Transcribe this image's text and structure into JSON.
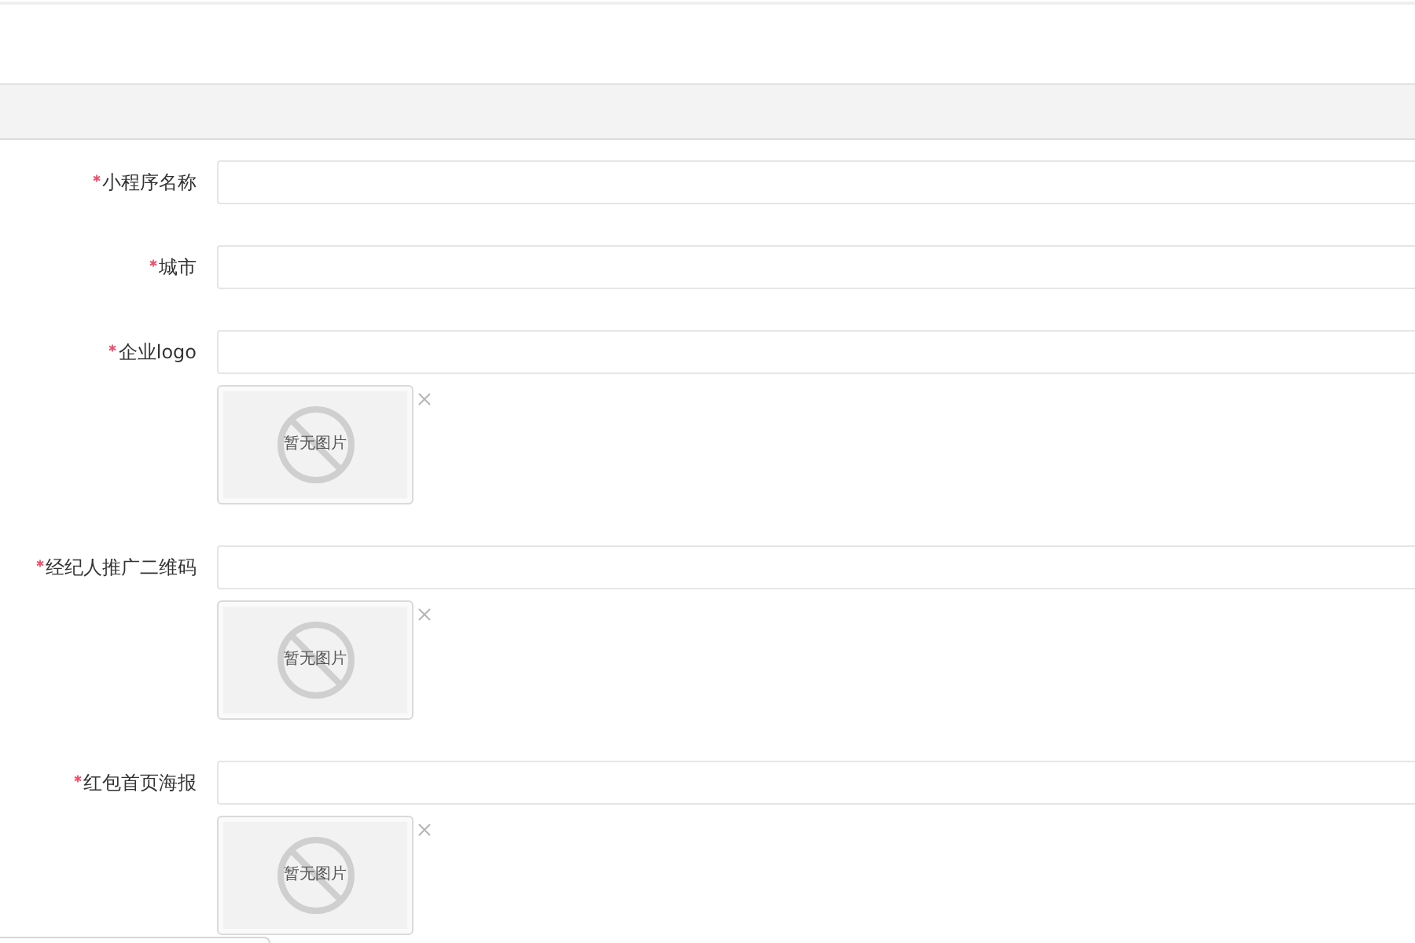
{
  "form": {
    "fields": [
      {
        "label": "小程序名称",
        "required": true,
        "kind": "text"
      },
      {
        "label": "城市",
        "required": true,
        "kind": "text"
      },
      {
        "label": "企业logo",
        "required": true,
        "kind": "image",
        "image_placeholder": "暂无图片"
      },
      {
        "label": "经纪人推广二维码",
        "required": true,
        "kind": "image",
        "image_placeholder": "暂无图片"
      },
      {
        "label": "红包首页海报",
        "required": true,
        "kind": "image",
        "image_placeholder": "暂无图片"
      }
    ]
  }
}
